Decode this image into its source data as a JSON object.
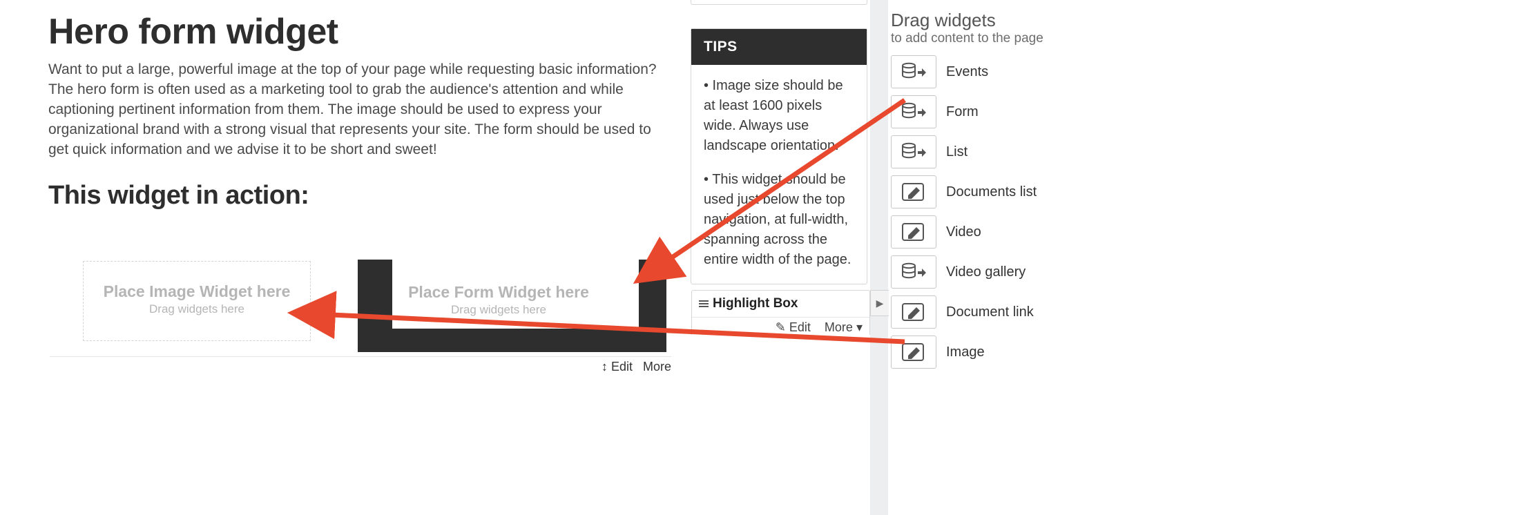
{
  "main": {
    "title": "Hero form widget",
    "description": "Want to put a large, powerful image at the top of your page while requesting basic information? The hero form is often used as a marketing tool to grab the audience's attention and while captioning pertinent information from them. The image should be used to express your organizational brand with a strong visual that represents your site. The form should be used to get quick information and we advise it to be short and sweet!",
    "sub_heading": "This widget in action:",
    "image_placeholder_title": "Place Image Widget here",
    "image_placeholder_sub": "Drag widgets here",
    "form_placeholder_title": "Place Form Widget here",
    "form_placeholder_sub": "Drag widgets here",
    "bottom_edit": "Edit",
    "bottom_more": "More"
  },
  "tips": {
    "heading": "TIPS",
    "items": [
      "• Image size should be at least 1600 pixels wide. Always use landscape orientation.",
      "• This widget should be used just below the top navigation, at full-width, spanning across the entire width of the page."
    ]
  },
  "highlight": {
    "title": "Highlight Box",
    "edit": "Edit",
    "more": "More"
  },
  "palette": {
    "title": "Drag widgets",
    "subtitle": "to add content to the page",
    "items": [
      {
        "icon": "db-arrow",
        "label": "Events"
      },
      {
        "icon": "db-arrow",
        "label": "Form"
      },
      {
        "icon": "db-arrow",
        "label": "List"
      },
      {
        "icon": "pencil",
        "label": "Documents list"
      },
      {
        "icon": "pencil",
        "label": "Video"
      },
      {
        "icon": "db-arrow",
        "label": "Video gallery"
      },
      {
        "icon": "pencil",
        "label": "Document link"
      },
      {
        "icon": "pencil",
        "label": "Image"
      }
    ]
  },
  "colors": {
    "arrow": "#e8492e"
  }
}
